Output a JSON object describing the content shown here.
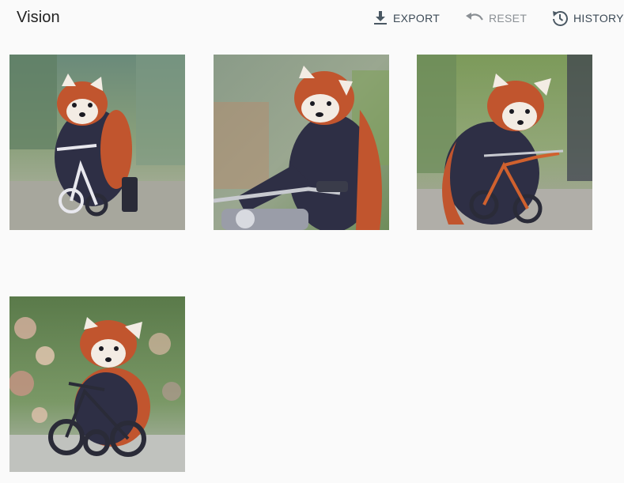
{
  "app": {
    "title": "Vision"
  },
  "toolbar": {
    "export_label": "EXPORT",
    "reset_label": "RESET",
    "history_label": "HISTORY",
    "export_icon": "download-icon",
    "reset_icon": "undo-icon",
    "history_icon": "history-icon",
    "reset_disabled": true
  },
  "gallery": {
    "images": [
      {
        "subject": "red panda",
        "scene": "riding white bicycle on forest path"
      },
      {
        "subject": "red panda",
        "scene": "riding motorcycle, close-up"
      },
      {
        "subject": "red panda",
        "scene": "riding orange bicycle on path"
      },
      {
        "subject": "red panda",
        "scene": "riding tricycle by flowering bushes"
      }
    ]
  },
  "colors": {
    "background": "#fafafa",
    "title": "#212121",
    "toolbar_text": "#3c4a56",
    "toolbar_disabled": "#8a8f94",
    "panda_fur": "#c1552e",
    "panda_dark": "#2e2f45"
  }
}
